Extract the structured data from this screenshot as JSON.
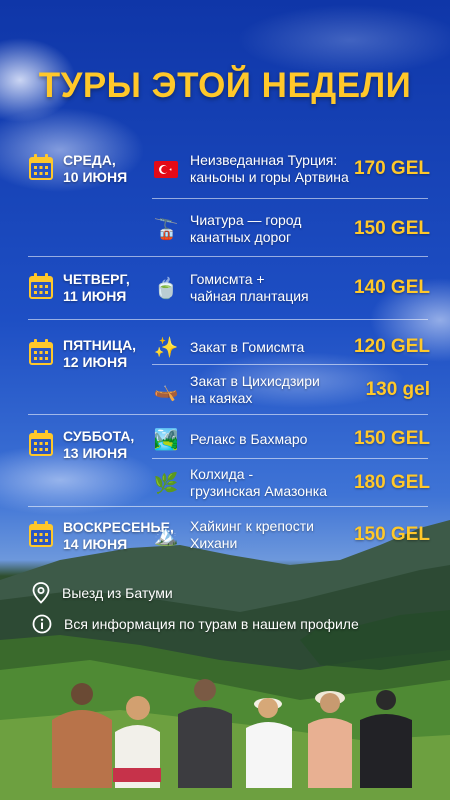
{
  "title": "ТУРЫ ЭТОЙ НЕДЕЛИ",
  "colors": {
    "accent": "#ffc82a",
    "text": "#ffffff",
    "sky": "#1e4fc4"
  },
  "days": [
    {
      "name": "СРЕДА,",
      "date": "10 ИЮНЯ",
      "icon": "calendar-icon"
    },
    {
      "name": "ЧЕТВЕРГ,",
      "date": "11 ИЮНЯ",
      "icon": "calendar-icon"
    },
    {
      "name": "ПЯТНИЦА,",
      "date": "12 ИЮНЯ",
      "icon": "calendar-icon"
    },
    {
      "name": "СУББОТА,",
      "date": "13 ИЮНЯ",
      "icon": "calendar-icon"
    },
    {
      "name": "ВОСКРЕСЕНЬЕ,",
      "date": "14 ИЮНЯ",
      "icon": "calendar-icon"
    }
  ],
  "tours": [
    {
      "icon": "turkey-flag-icon",
      "emoji": "🇹🇷",
      "line1": "Неизведанная Турция:",
      "line2": "каньоны и горы Артвина",
      "price": "170 GEL"
    },
    {
      "icon": "cable-car-icon",
      "emoji": "🚡",
      "line1": "Чиатура — город",
      "line2": "канатных дорог",
      "price": "150 GEL"
    },
    {
      "icon": "tea-icon",
      "emoji": "🍵",
      "line1": "Гомисмта +",
      "line2": "чайная плантация",
      "price": "140 GEL"
    },
    {
      "icon": "sparkles-icon",
      "emoji": "✨",
      "line1": "Закат в Гомисмта",
      "line2": "",
      "price": "120 GEL"
    },
    {
      "icon": "kayak-icon",
      "emoji": "🛶",
      "line1": "Закат в Цихисдзири",
      "line2": "на каяках",
      "price": "130 gel"
    },
    {
      "icon": "landscape-icon",
      "emoji": "🏞️",
      "line1": "Релакс в Бахмаро",
      "line2": "",
      "price": "150 GEL"
    },
    {
      "icon": "herb-icon",
      "emoji": "🌿",
      "line1": "Колхида -",
      "line2": "грузинская Амазонка",
      "price": "180 GEL"
    },
    {
      "icon": "mountain-icon",
      "emoji": "🏔️",
      "line1": "Хайкинг к крепости",
      "line2": "Хихани",
      "price": "150 GEL"
    }
  ],
  "info": {
    "departure": "Выезд из Батуми",
    "profile": "Вся информация по турам в нашем профиле"
  }
}
